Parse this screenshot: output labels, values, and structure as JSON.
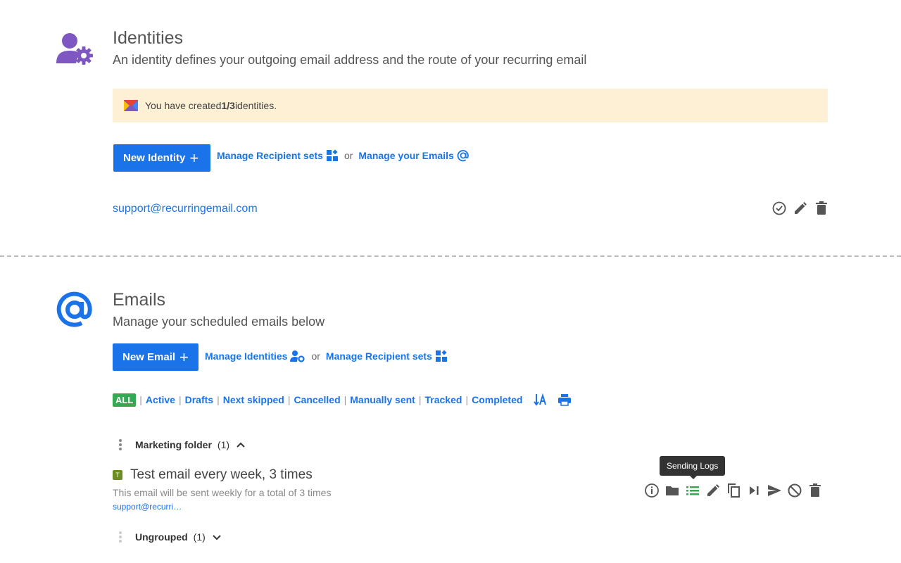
{
  "identities": {
    "title": "Identities",
    "subtitle": "An identity defines your outgoing email address and the route of your recurring email",
    "notice": {
      "prefix": "You have created ",
      "count": "1/3",
      "suffix": " identities."
    },
    "new_button": "New Identity",
    "manage_recipients_link": "Manage Recipient sets",
    "or_text": "or",
    "manage_emails_link": "Manage your Emails",
    "items": [
      {
        "email": "support@recurringemail.com"
      }
    ],
    "icon": "user-gear-icon",
    "accent_color": "#7e57c2"
  },
  "emails": {
    "title": "Emails",
    "subtitle": "Manage your scheduled emails below",
    "new_button": "New Email",
    "manage_identities_link": "Manage Identities",
    "or_text": "or",
    "manage_recipients_link": "Manage Recipient sets",
    "filters": [
      "ALL",
      "Active",
      "Drafts",
      "Next skipped",
      "Cancelled",
      "Manually sent",
      "Tracked",
      "Completed"
    ],
    "folders": [
      {
        "name": "Marketing folder",
        "count": "(1)",
        "expanded": true,
        "items": [
          {
            "badge": "T",
            "title": "Test email every week, 3 times",
            "description": "This email will be sent weekly for a total of 3 times",
            "from": "support@recurri…"
          }
        ]
      },
      {
        "name": "Ungrouped",
        "count": "(1)",
        "expanded": false
      }
    ],
    "tooltip": "Sending Logs",
    "accent_color": "#1a73e8"
  }
}
